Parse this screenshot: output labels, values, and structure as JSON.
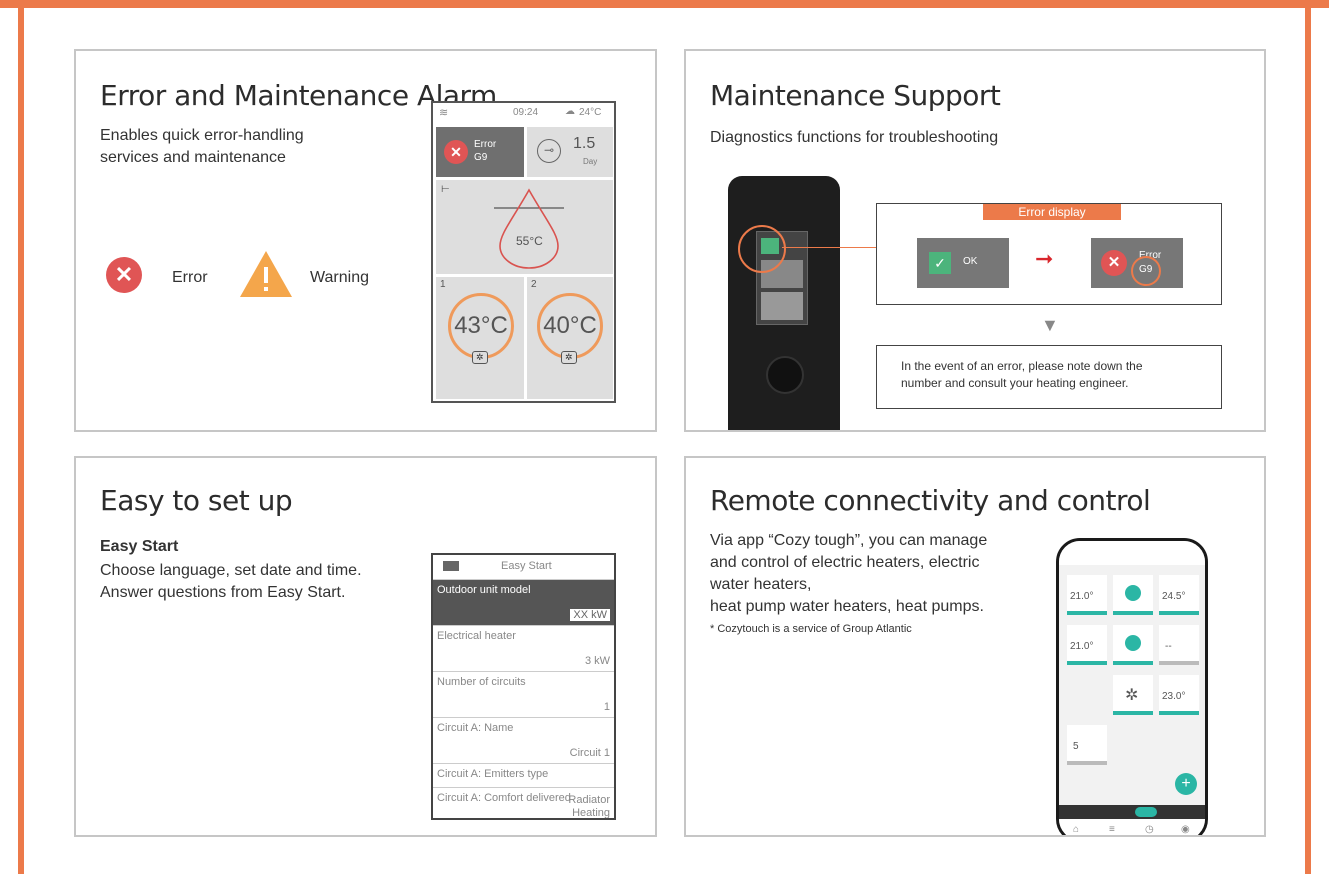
{
  "colors": {
    "accent": "#ec7a4a",
    "error": "#e05555",
    "warning": "#f4a64b",
    "ok": "#4cb47c",
    "teal": "#2bb6a5"
  },
  "error_alarm": {
    "title": "Error and Maintenance Alarm",
    "desc_line1": "Enables quick error-handling",
    "desc_line2": "services and maintenance",
    "error_label": "Error",
    "warning_label": "Warning",
    "device": {
      "time": "09:24",
      "weather": "24°C",
      "error_title": "Error",
      "error_code": "G9",
      "maint_value": "1.5",
      "maint_unit": "Day",
      "tank_temp": "55°C",
      "zone1_num": "1",
      "zone1_temp": "43°C",
      "zone2_num": "2",
      "zone2_temp": "40°C"
    }
  },
  "maintenance_support": {
    "title": "Maintenance Support",
    "desc": "Diagnostics functions for troubleshooting",
    "error_display_label": "Error display",
    "ok_label": "OK",
    "error_title": "Error",
    "error_code": "G9",
    "note_line1": "In the event of an error, please note down the",
    "note_line2": "number and consult your heating engineer."
  },
  "easy_setup": {
    "title": "Easy to set up",
    "subtitle": "Easy Start",
    "desc_line1": "Choose language, set date and time.",
    "desc_line2": "Answer questions from Easy Start.",
    "screen": {
      "header": "Easy Start",
      "rows": [
        {
          "key": "Outdoor unit model",
          "value": "XX kW"
        },
        {
          "key": "Electrical heater",
          "value": "3 kW"
        },
        {
          "key": "Number of circuits",
          "value": "1"
        },
        {
          "key": "Circuit A: Name",
          "value": "Circuit 1"
        },
        {
          "key": "Circuit A: Emitters type",
          "value": "Radiator"
        },
        {
          "key": "Circuit A: Comfort delivered",
          "value": "Heating"
        }
      ]
    }
  },
  "remote": {
    "title": "Remote connectivity and control",
    "line1": "Via app “Cozy tough”, you can manage",
    "line2": "and control of electric heaters, electric",
    "line3": "water heaters,",
    "line4": "heat pump water heaters, heat pumps.",
    "footnote": "* Cozytouch is a service of Group Atlantic",
    "phone": {
      "t1": "21.0°",
      "t2": "24.5°",
      "t3": "21.0°",
      "t4": "--",
      "t5": "23.0°",
      "t6": "5"
    }
  }
}
